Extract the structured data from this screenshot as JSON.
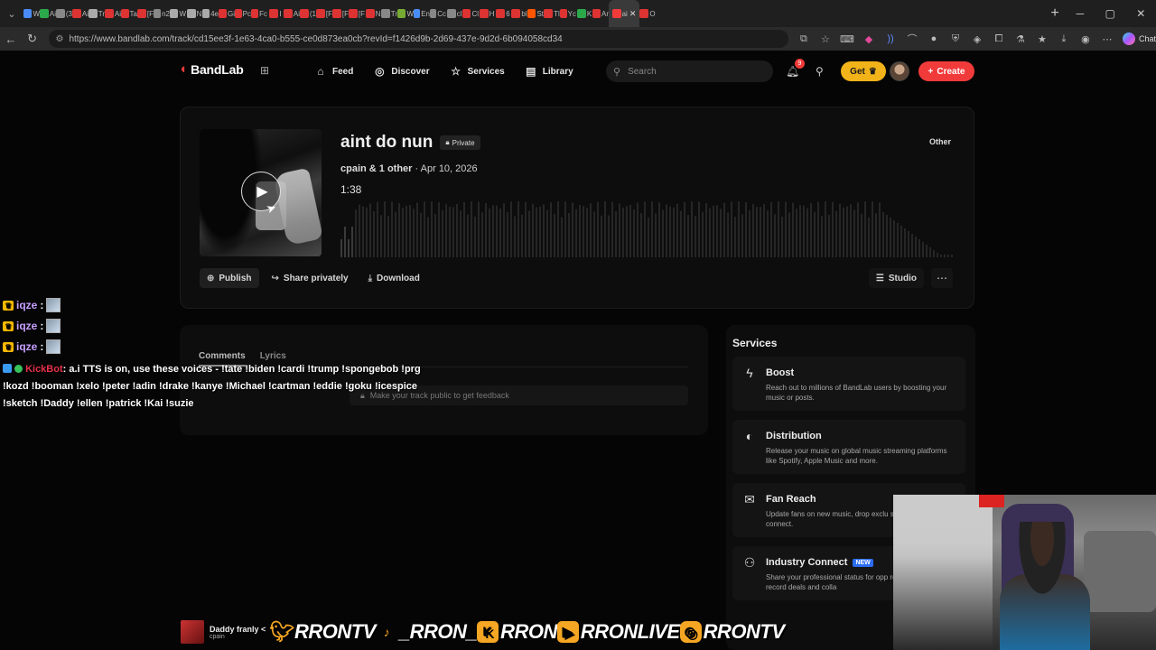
{
  "browser": {
    "url": "https://www.bandlab.com/track/cd15ee3f-1e63-4ca0-b555-ce0d873ea0cb?revId=f1426d9b-2d69-437e-9d2d-6b094058cd34",
    "chat_label": "Chat",
    "tabs": [
      {
        "label": "W",
        "color": "#4a8cf7"
      },
      {
        "label": "Ai",
        "color": "#2ba84a"
      },
      {
        "label": "(3",
        "color": "#888"
      },
      {
        "label": "Ai",
        "color": "#d33"
      },
      {
        "label": "Tr",
        "color": "#aaa"
      },
      {
        "label": "Ai",
        "color": "#d33"
      },
      {
        "label": "Ta",
        "color": "#d33"
      },
      {
        "label": "[F",
        "color": "#d33"
      },
      {
        "label": "n2",
        "color": "#888"
      },
      {
        "label": "W",
        "color": "#aaa"
      },
      {
        "label": "N",
        "color": "#aaa"
      },
      {
        "label": "4e",
        "color": "#aaa"
      },
      {
        "label": "Gi",
        "color": "#d33"
      },
      {
        "label": "Pc",
        "color": "#d33"
      },
      {
        "label": "Fc",
        "color": "#d33"
      },
      {
        "label": "I",
        "color": "#d33"
      },
      {
        "label": "Ai",
        "color": "#d33"
      },
      {
        "label": "(1",
        "color": "#d33"
      },
      {
        "label": "[F",
        "color": "#d33"
      },
      {
        "label": "[F",
        "color": "#d33"
      },
      {
        "label": "[F",
        "color": "#d33"
      },
      {
        "label": "N",
        "color": "#d33"
      },
      {
        "label": "Tr",
        "color": "#888"
      },
      {
        "label": "W",
        "color": "#7a3"
      },
      {
        "label": "En",
        "color": "#4a8cf7"
      },
      {
        "label": "Cc",
        "color": "#888"
      },
      {
        "label": "cl",
        "color": "#888"
      },
      {
        "label": "Cl",
        "color": "#d33"
      },
      {
        "label": "H",
        "color": "#d33"
      },
      {
        "label": "6",
        "color": "#d33"
      },
      {
        "label": "bl",
        "color": "#d33"
      },
      {
        "label": "St",
        "color": "#f50"
      },
      {
        "label": "Tl",
        "color": "#d33"
      },
      {
        "label": "Yc",
        "color": "#d33"
      },
      {
        "label": "K",
        "color": "#2ba84a"
      },
      {
        "label": "Ar",
        "color": "#d33"
      }
    ],
    "active_tab": {
      "label": "ai",
      "color": "#f13b3b"
    },
    "last_tab": {
      "label": "O",
      "color": "#d33"
    }
  },
  "header": {
    "brand": "BandLab",
    "nav": [
      {
        "label": "Feed",
        "icon": "home-icon"
      },
      {
        "label": "Discover",
        "icon": "compass-icon"
      },
      {
        "label": "Services",
        "icon": "star-icon"
      },
      {
        "label": "Library",
        "icon": "library-icon"
      }
    ],
    "search_placeholder": "Search",
    "notification_count": "9",
    "get_label": "Get",
    "create_label": "Create"
  },
  "track": {
    "title": "aint do nun",
    "privacy": "Private",
    "genre": "Other",
    "artist": "cpain & 1 other",
    "date": "· Apr 10, 2026",
    "duration": "1:38",
    "actions": {
      "publish": "Publish",
      "share": "Share privately",
      "download": "Download",
      "studio": "Studio"
    }
  },
  "comments": {
    "tabs": [
      "Comments",
      "Lyrics"
    ],
    "feedback_note": "Make your track public to get feedback"
  },
  "services": {
    "heading": "Services",
    "items": [
      {
        "name": "Boost",
        "icon": "bolt-icon",
        "desc": "Reach out to millions of BandLab users by boosting your music or posts."
      },
      {
        "name": "Distribution",
        "icon": "distribution-icon",
        "desc": "Release your music on global music streaming platforms like Spotify, Apple Music and more."
      },
      {
        "name": "Fan Reach",
        "icon": "mail-icon",
        "desc": "Update fans on new music, drop exclu simply reach out to connect."
      },
      {
        "name": "Industry Connect",
        "icon": "people-icon",
        "badge": "NEW",
        "desc": "Share your professional status for opp representation, record deals and colla"
      }
    ]
  },
  "overlay": {
    "chat": [
      {
        "user": "iqze",
        "sep": ":"
      },
      {
        "user": "iqze",
        "sep": ":"
      },
      {
        "user": "iqze",
        "sep": ":"
      }
    ],
    "bot_name": "KickBot",
    "bot_message": ": a.i TTS is on, use these voices - !tate !biden !cardi !trump !spongebob !prg !kozd !booman !xelo !peter !adin !drake !kanye !Michael !cartman !eddie !goku !icespice !sketch !Daddy !ellen !patrick !Kai !suzie",
    "now_playing_title": "Daddy franly <",
    "now_playing_artist": "cpain",
    "handles": [
      "RRONTV",
      "_RRON_",
      "RRON",
      "RRONLIVE",
      "RRONTV"
    ]
  },
  "colors": {
    "brand_red": "#f13b3b",
    "get_yellow": "#f2b31a",
    "social_accent": "#f5a623"
  }
}
